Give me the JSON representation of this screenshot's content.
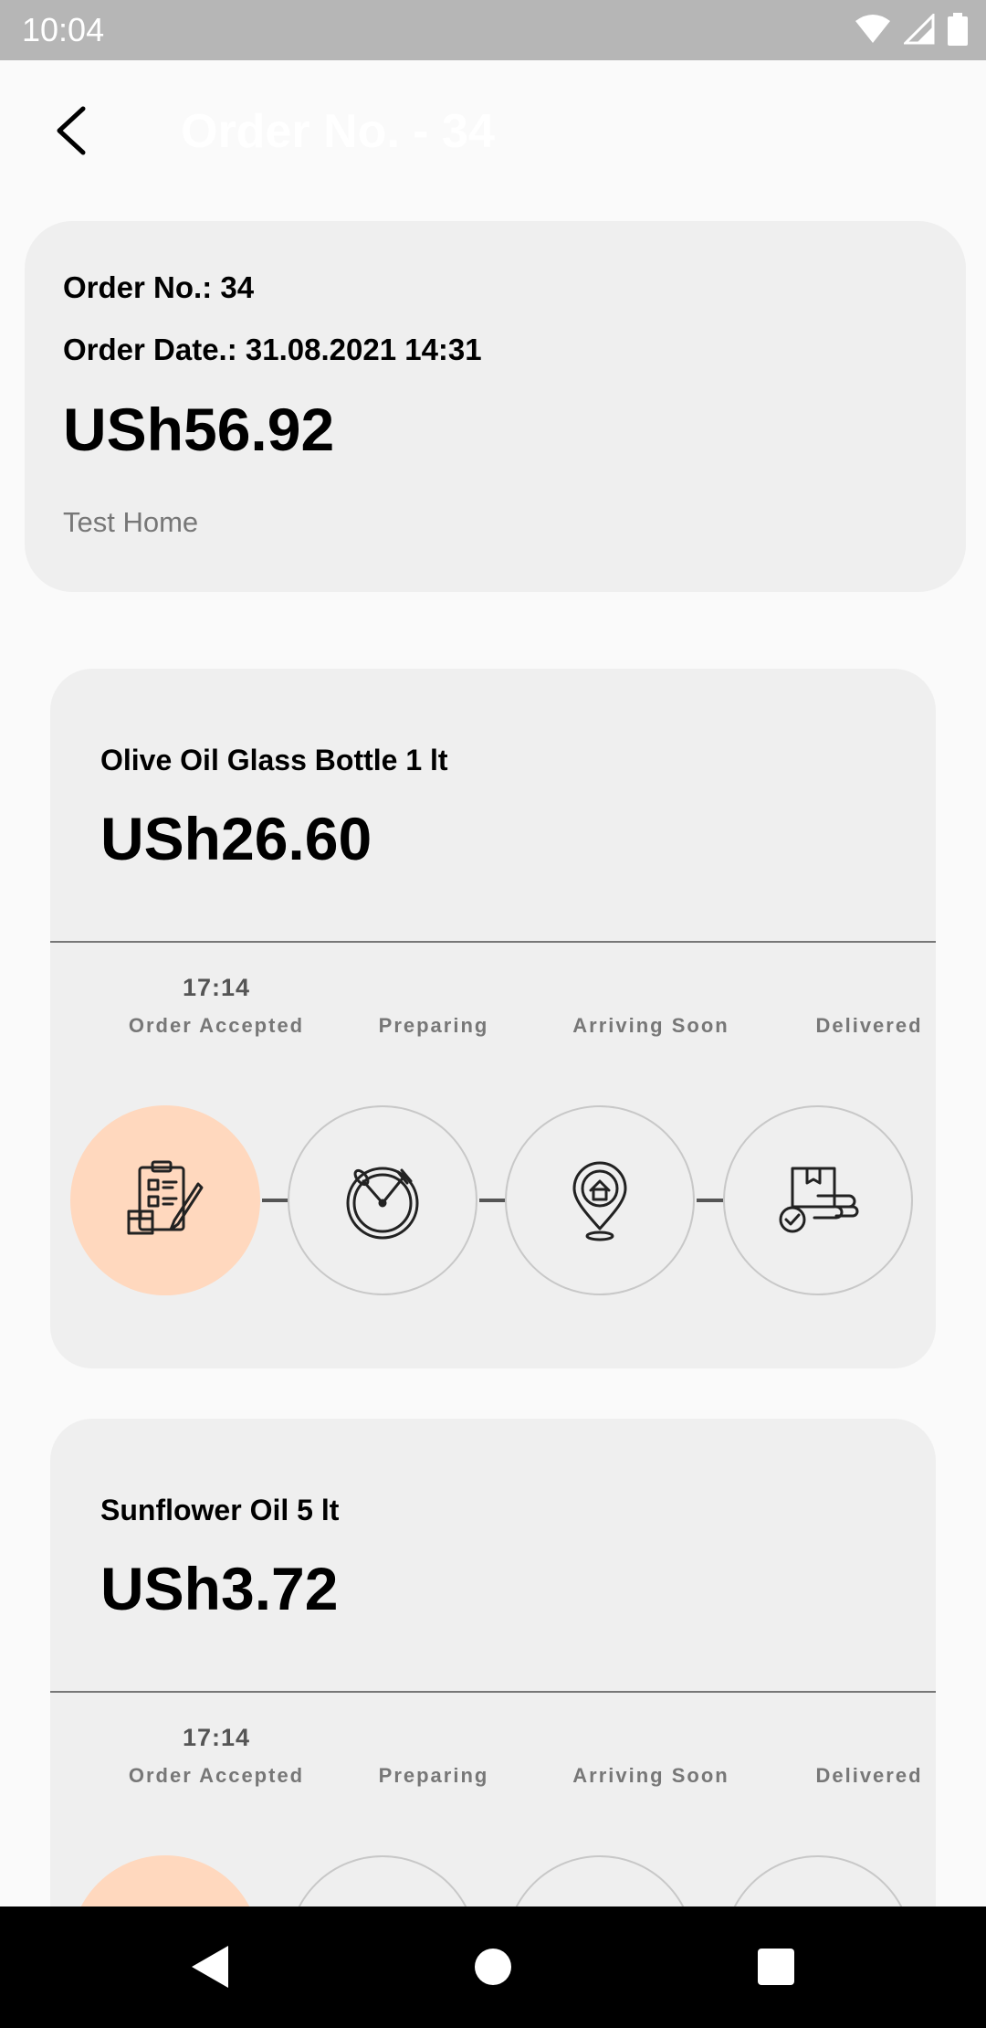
{
  "status_bar": {
    "time": "10:04"
  },
  "app_bar": {
    "title": "Order No. - 34"
  },
  "summary": {
    "order_no": "Order No.: 34",
    "order_date": "Order Date.: 31.08.2021 14:31",
    "total": "USh56.92",
    "address": "Test Home"
  },
  "items": [
    {
      "name": "Olive Oil Glass Bottle 1 lt",
      "price": "USh26.60",
      "steps": [
        {
          "label": "Order Accepted",
          "time": "17:14",
          "icon": "order-clipboard-icon"
        },
        {
          "label": "Preparing",
          "time": "",
          "icon": "preparing-clock-icon"
        },
        {
          "label": "Arriving Soon",
          "time": "",
          "icon": "location-home-icon"
        },
        {
          "label": "Delivered",
          "time": "",
          "icon": "delivered-box-icon"
        }
      ]
    },
    {
      "name": "Sunflower Oil 5 lt",
      "price": "USh3.72",
      "steps": [
        {
          "label": "Order Accepted",
          "time": "17:14",
          "icon": "order-clipboard-icon"
        },
        {
          "label": "Preparing",
          "time": "",
          "icon": "preparing-clock-icon"
        },
        {
          "label": "Arriving Soon",
          "time": "",
          "icon": "location-home-icon"
        },
        {
          "label": "Delivered",
          "time": "",
          "icon": "delivered-box-icon"
        }
      ]
    }
  ],
  "colors": {
    "active_step": "#ffd8be",
    "card": "#efefef",
    "status_bar": "#b6b6b6"
  }
}
